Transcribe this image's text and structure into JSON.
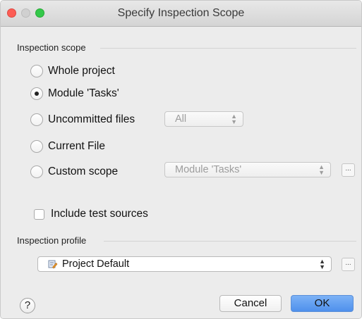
{
  "window": {
    "title": "Specify Inspection Scope"
  },
  "scope": {
    "section_label": "Inspection scope",
    "options": [
      {
        "label": "Whole project",
        "checked": false
      },
      {
        "label": "Module 'Tasks'",
        "checked": true
      },
      {
        "label": "Uncommitted files",
        "checked": false
      },
      {
        "label": "Current File",
        "checked": false
      },
      {
        "label": "Custom scope",
        "checked": false
      }
    ],
    "uncommitted_combo": "All",
    "custom_combo": "Module 'Tasks'",
    "include_tests_label": "Include test sources",
    "include_tests_checked": false
  },
  "profile": {
    "section_label": "Inspection profile",
    "value": "Project Default",
    "icon": "inspection-profile-icon"
  },
  "buttons": {
    "browse": "...",
    "help": "?",
    "cancel": "Cancel",
    "ok": "OK"
  },
  "colors": {
    "accent": "#4f90ec",
    "close": "#fc5d55",
    "maximize": "#34c84a"
  }
}
